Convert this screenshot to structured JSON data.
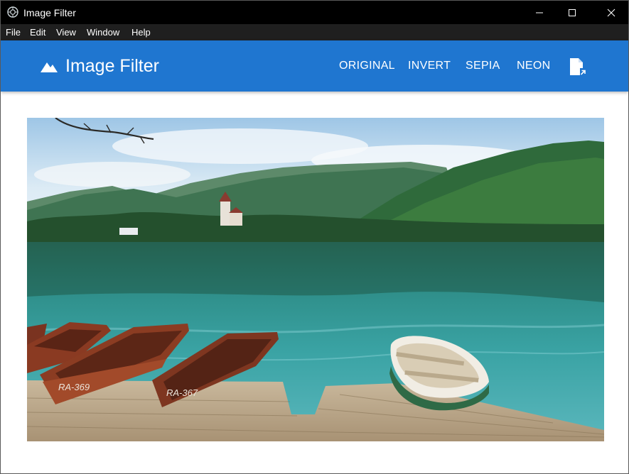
{
  "window": {
    "title": "Image Filter",
    "controls": [
      "minimize-icon",
      "maximize-icon",
      "close-icon"
    ]
  },
  "menu": {
    "items": [
      "File",
      "Edit",
      "View",
      "Window",
      "Help"
    ]
  },
  "appbar": {
    "title": "Image Filter",
    "brand_icon": "mountains-icon",
    "filters": [
      "ORIGINAL",
      "INVERT",
      "SEPIA",
      "NEON"
    ],
    "file_icon": "open-file-icon",
    "color": "#1f76d0"
  },
  "photo": {
    "boat_labels": [
      "RA-369",
      "RA-367"
    ]
  }
}
